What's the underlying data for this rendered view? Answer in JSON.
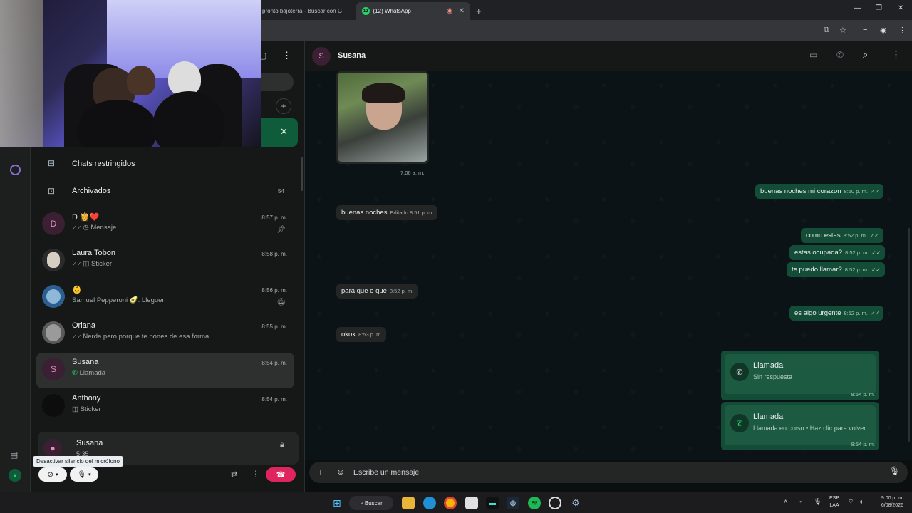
{
  "browser": {
    "tabs": [
      {
        "label": "pronto bajoterra - Buscar con G"
      },
      {
        "label": "(12) WhatsApp",
        "badge": "12"
      }
    ],
    "new_tab": "+"
  },
  "sidebar": {
    "restricted": "Chats restringidos",
    "archived": "Archivados",
    "archived_count": "54",
    "chats": [
      {
        "name": "D 👸❤️",
        "avatar": "D",
        "msg": "Mensaje",
        "time": "8:57 p. m.",
        "pinned": true
      },
      {
        "name": "Laura Tobon",
        "avatar": "",
        "msg": "Sticker",
        "time": "8:58 p. m."
      },
      {
        "name": "👶",
        "avatar": "",
        "msg": "Samuel Pepperoni 🥑: Lleguen",
        "time": "8:56 p. m.",
        "muted": true
      },
      {
        "name": "Oriana",
        "avatar": "",
        "msg": "Ñerda pero porque te pones de esa forma",
        "time": "8:55 p. m."
      },
      {
        "name": "Susana",
        "avatar": "S",
        "msg": "Llamada",
        "time": "8:54 p. m.",
        "selected": true
      },
      {
        "name": "Anthony",
        "avatar": "",
        "msg": "Sticker",
        "time": "8:54 p. m."
      }
    ]
  },
  "call": {
    "name": "Susana",
    "duration": "5:35",
    "tooltip": "Desactivar silencio del micrófono"
  },
  "chat": {
    "title": "Susana",
    "avatar": "S",
    "image_time": "7:06 a. m.",
    "messages": [
      {
        "dir": "out",
        "text": "buenas noches mi corazon",
        "time": "8:50 p. m."
      },
      {
        "dir": "in",
        "text": "buenas noches",
        "time": "Editado 8:51 p. m."
      },
      {
        "dir": "out",
        "text": "como estas",
        "time": "8:52 p. m."
      },
      {
        "dir": "out",
        "text": "estas ocupada?",
        "time": "8:52 p. m."
      },
      {
        "dir": "out",
        "text": "te puedo llamar?",
        "time": "8:52 p. m."
      },
      {
        "dir": "in",
        "text": "para que o que",
        "time": "8:52 p. m."
      },
      {
        "dir": "out",
        "text": "es algo urgente",
        "time": "8:52 p. m."
      },
      {
        "dir": "in",
        "text": "okok",
        "time": "8:53 p. m."
      }
    ],
    "calls": [
      {
        "title": "Llamada",
        "sub": "Sin respuesta",
        "time": "8:54 p. m."
      },
      {
        "title": "Llamada",
        "sub": "Llamada en curso • Haz clic para volver",
        "time": "8:54 p. m."
      }
    ],
    "composer_placeholder": "Escribe un mensaje"
  },
  "taskbar": {
    "search": "Buscar",
    "lang1": "ESP",
    "lang2": "LAA",
    "time": "9:00 p. m.",
    "date": "6/08/2026"
  },
  "colors": {
    "accent": "#25d366",
    "outgoing": "#144d37",
    "incoming": "#242626",
    "end_call": "#e0245e"
  }
}
